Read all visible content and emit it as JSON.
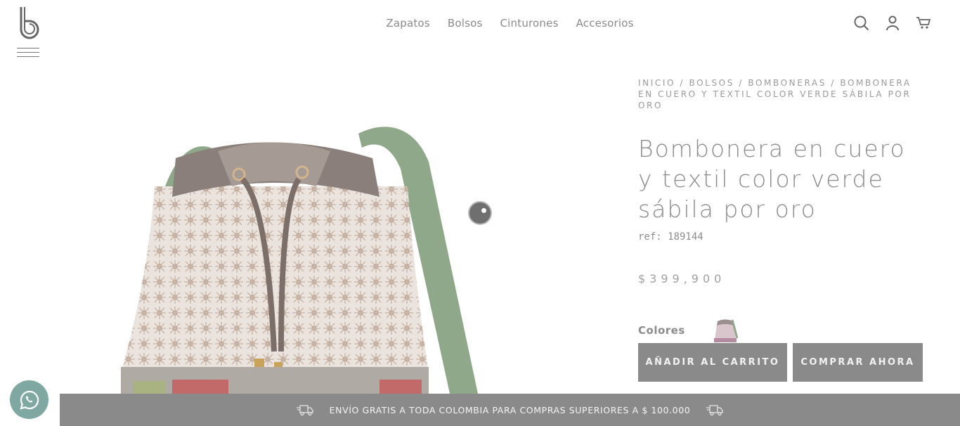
{
  "header": {
    "logo_icon": "brand-b-logo",
    "menu_icon": "hamburger-icon",
    "nav": [
      {
        "label": "Zapatos"
      },
      {
        "label": "Bolsos"
      },
      {
        "label": "Cinturones"
      },
      {
        "label": "Accesorios"
      }
    ],
    "icons": [
      "search-icon",
      "user-icon",
      "cart-icon"
    ]
  },
  "product": {
    "breadcrumb": "INICIO / BOLSOS / BOMBONERAS / BOMBONERA EN CUERO Y TEXTIL COLOR VERDE SÁBILA POR ORO",
    "title": "Bombonera en cuero y textil color verde sábila por oro",
    "ref": "ref: 189144",
    "price": "$399,900",
    "colors_label": "Colores",
    "add_to_cart_label": "AÑADIR AL CARRITO",
    "buy_now_label": "COMPRAR AHORA"
  },
  "promo": {
    "text": "ENVÍO GRATIS A TODA COLOMBIA PARA COMPRAS SUPERIORES A $ 100.000",
    "icon": "delivery-truck-icon"
  },
  "colors": {
    "bar": "#8a8a8a",
    "whatsapp": "#7fa8a3",
    "strap_green": "#8fa889"
  }
}
